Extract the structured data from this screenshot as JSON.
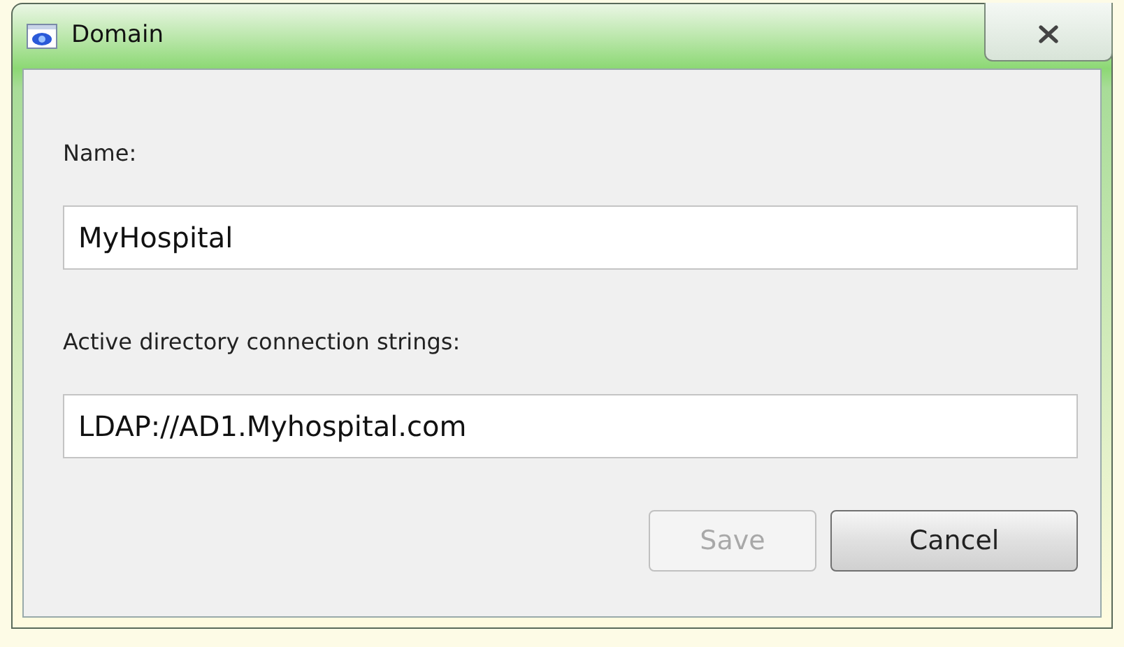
{
  "window": {
    "title": "Domain"
  },
  "fields": [
    {
      "label": "Name:",
      "value": "MyHospital"
    },
    {
      "label": "Active directory connection strings:",
      "value": "LDAP://AD1.Myhospital.com"
    }
  ],
  "buttons": [
    {
      "label": "Save",
      "disabled": true
    },
    {
      "label": "Cancel",
      "disabled": false
    }
  ]
}
